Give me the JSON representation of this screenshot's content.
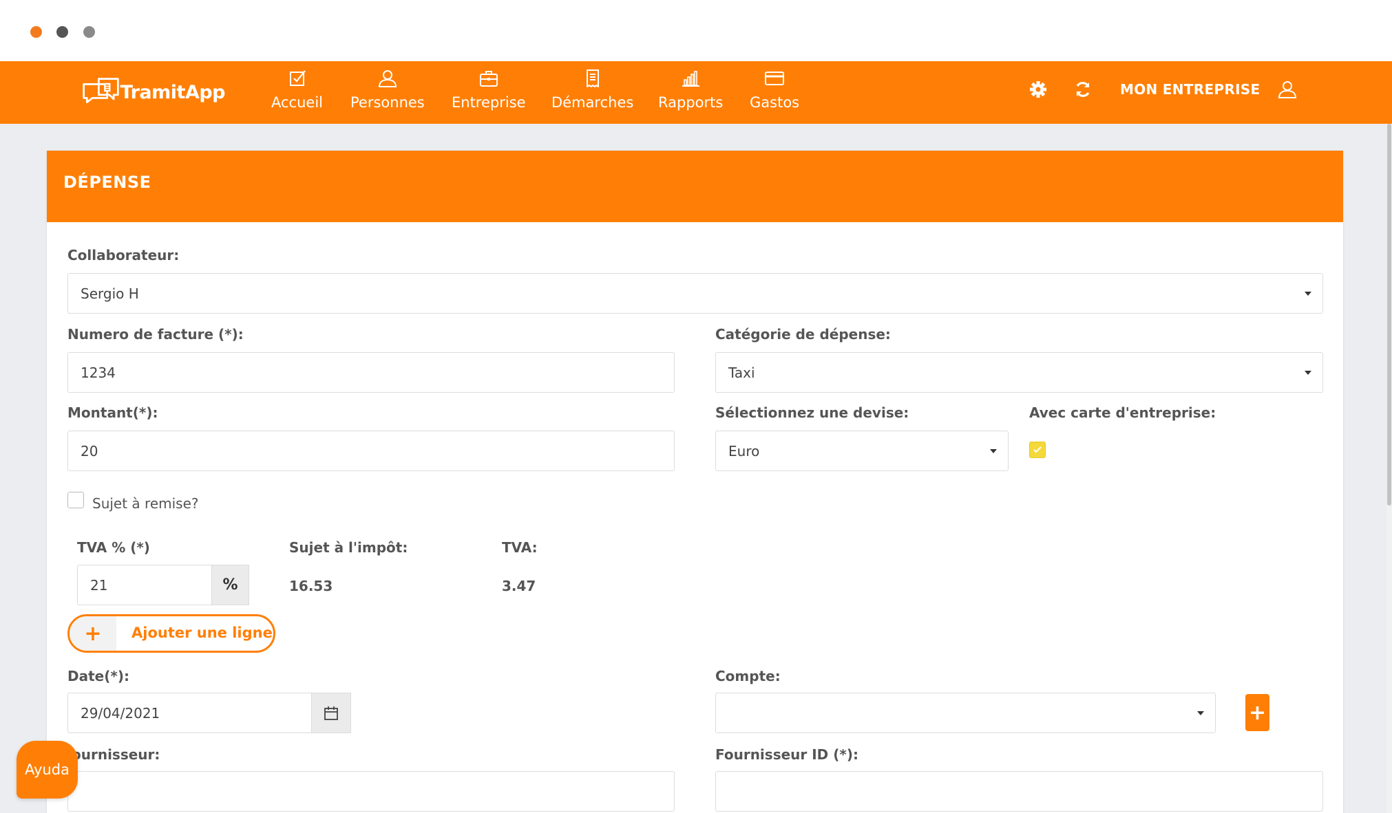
{
  "nav": {
    "brand": {
      "name": "Tramit",
      "suffix": "App"
    },
    "items": [
      {
        "label": "Accueil",
        "icon": "checkbox-icon"
      },
      {
        "label": "Personnes",
        "icon": "user-icon"
      },
      {
        "label": "Entreprise",
        "icon": "briefcase-icon"
      },
      {
        "label": "Démarches",
        "icon": "document-icon"
      },
      {
        "label": "Rapports",
        "icon": "bar-chart-icon"
      },
      {
        "label": "Gastos",
        "icon": "credit-card-icon"
      }
    ],
    "company": "MON ENTREPRISE"
  },
  "card": {
    "title": "DÉPENSE"
  },
  "form": {
    "collaborateur": {
      "label": "Collaborateur:",
      "value": "Sergio H"
    },
    "numero_facture": {
      "label": "Numero de facture (*):",
      "value": "1234"
    },
    "categorie": {
      "label": "Catégorie de dépense:",
      "value": "Taxi"
    },
    "montant": {
      "label": "Montant(*):",
      "value": "20"
    },
    "devise": {
      "label": "Sélectionnez une devise:",
      "value": "Euro"
    },
    "carte_entreprise": {
      "label": "Avec carte d'entreprise:",
      "checked": true
    },
    "sujet_remise": {
      "label": "Sujet à remise?",
      "checked": false
    },
    "tva_percent": {
      "label": "TVA % (*)",
      "value": "21",
      "suffix": "%"
    },
    "sujet_impot": {
      "label": "Sujet à l'impôt:",
      "value": "16.53"
    },
    "tva": {
      "label": "TVA:",
      "value": "3.47"
    },
    "add_line": {
      "label": "Ajouter une ligne",
      "icon": "+"
    },
    "date": {
      "label": "Date(*):",
      "value": "29/04/2021"
    },
    "compte": {
      "label": "Compte:",
      "value": "",
      "add_icon": "+"
    },
    "fournisseur": {
      "label": "ournisseur:",
      "value": ""
    },
    "fournisseur_id": {
      "label": "Fournisseur ID (*):",
      "value": ""
    }
  },
  "help": {
    "label": "Ayuda"
  },
  "colors": {
    "accent": "#ff7f06",
    "checkbox_checked": "#f5d83a",
    "background": "#ebedf0"
  }
}
